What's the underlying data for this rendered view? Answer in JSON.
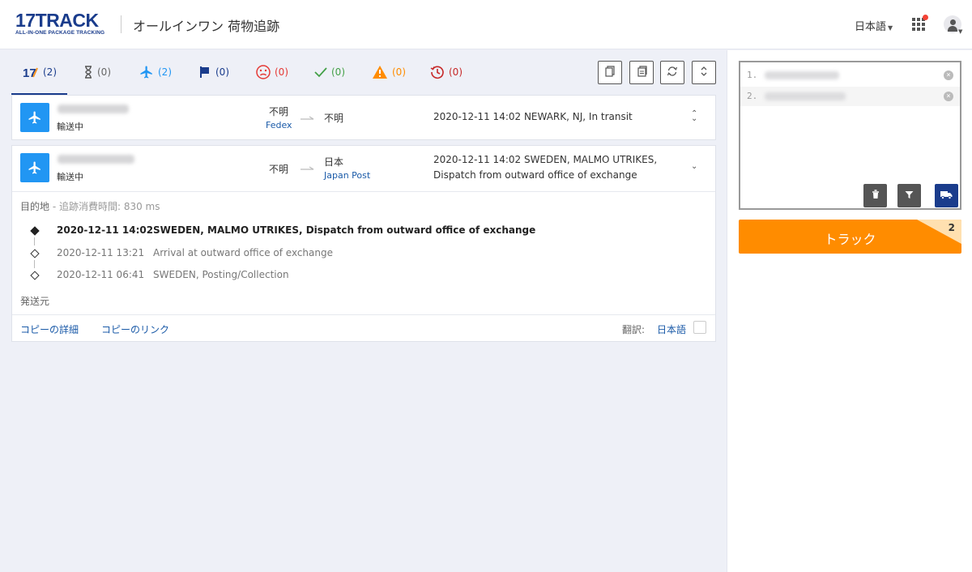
{
  "header": {
    "logo_main": "17TRACK",
    "logo_sub": "ALL-IN-ONE PACKAGE TRACKING",
    "title": "オールインワン 荷物追跡",
    "language": "日本語"
  },
  "filter_tabs": [
    {
      "icon": "17-logo-icon",
      "count": "(2)",
      "color": "#1a3c8c"
    },
    {
      "icon": "hourglass-icon",
      "count": "(0)",
      "color": "#666666"
    },
    {
      "icon": "airplane-icon",
      "count": "(2)",
      "color": "#2196f3"
    },
    {
      "icon": "flag-icon",
      "count": "(0)",
      "color": "#1a3c8c"
    },
    {
      "icon": "sad-face-icon",
      "count": "(0)",
      "color": "#e53935"
    },
    {
      "icon": "check-icon",
      "count": "(0)",
      "color": "#43a047"
    },
    {
      "icon": "warning-icon",
      "count": "(0)",
      "color": "#ff8c00"
    },
    {
      "icon": "expired-clock-icon",
      "count": "(0)",
      "color": "#c62828"
    }
  ],
  "toolbar": {
    "buttons": [
      "copy-icon",
      "copy-all-icon",
      "refresh-icon",
      "expand-all-icon"
    ]
  },
  "shipments": [
    {
      "status": "輸送中",
      "origin": "不明",
      "carrier_from": "Fedex",
      "destination": "不明",
      "carrier_to": "",
      "event_line1": "2020-12-11 14:02  NEWARK, NJ, In transit",
      "event_line2": ""
    },
    {
      "status": "輸送中",
      "origin": "不明",
      "carrier_from": "",
      "destination": "日本",
      "carrier_to": "Japan Post",
      "event_line1": "2020-12-11 14:02  SWEDEN, MALMO UTRIKES,",
      "event_line2": "Dispatch from outward office of exchange"
    }
  ],
  "detail": {
    "destination_label": "目的地",
    "elapsed_label": " - 追跡消費時間: 830 ms",
    "origin_label": "発送元",
    "events": [
      {
        "time": "2020-12-11 14:02",
        "desc": "SWEDEN, MALMO UTRIKES, Dispatch from outward office of exchange"
      },
      {
        "time": "2020-12-11 13:21",
        "desc": "Arrival at outward office of exchange"
      },
      {
        "time": "2020-12-11 06:41",
        "desc": "SWEDEN, Posting/Collection"
      }
    ],
    "copy_detail": "コピーの詳細",
    "copy_link": "コピーのリンク",
    "translate_label": "翻訳:",
    "translate_lang": "日本語"
  },
  "input_panel": {
    "rows": [
      {
        "index": "1."
      },
      {
        "index": "2."
      }
    ],
    "track_label": "トラック",
    "track_count": "2",
    "button_colors": {
      "delete": "#555555",
      "filter": "#555555",
      "carrier": "#1a3c8c"
    }
  }
}
